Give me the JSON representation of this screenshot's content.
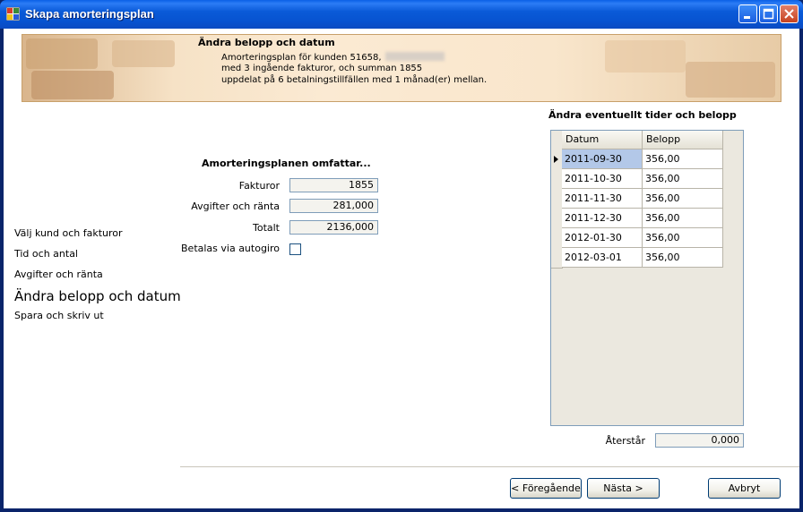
{
  "window": {
    "title": "Skapa amorteringsplan"
  },
  "banner": {
    "title": "Ändra belopp och datum",
    "line1_prefix": "Amorteringsplan för kunden 51658,",
    "line2": "med 3 ingående fakturor, och summan 1855",
    "line3": "uppdelat på 6 betalningstillfällen med 1 månad(er) mellan."
  },
  "nav": {
    "items": [
      {
        "label": "Välj kund och fakturor",
        "active": false
      },
      {
        "label": "Tid och antal",
        "active": false
      },
      {
        "label": "Avgifter och ränta",
        "active": false
      },
      {
        "label": "Ändra belopp och datum",
        "active": true
      },
      {
        "label": "Spara och skriv ut",
        "active": false
      }
    ]
  },
  "summary": {
    "heading": "Amorteringsplanen omfattar...",
    "fakturor_label": "Fakturor",
    "fakturor_value": "1855",
    "avgifter_label": "Avgifter och ränta",
    "avgifter_value": "281,000",
    "totalt_label": "Totalt",
    "totalt_value": "2136,000",
    "autogiro_label": "Betalas via autogiro",
    "autogiro_checked": false
  },
  "schedule": {
    "heading": "Ändra eventuellt tider och belopp",
    "columns": [
      "Datum",
      "Belopp"
    ],
    "rows": [
      {
        "datum": "2011-09-30",
        "belopp": "356,00"
      },
      {
        "datum": "2011-10-30",
        "belopp": "356,00"
      },
      {
        "datum": "2011-11-30",
        "belopp": "356,00"
      },
      {
        "datum": "2011-12-30",
        "belopp": "356,00"
      },
      {
        "datum": "2012-01-30",
        "belopp": "356,00"
      },
      {
        "datum": "2012-03-01",
        "belopp": "356,00"
      }
    ],
    "remaining_label": "Återstår",
    "remaining_value": "0,000"
  },
  "buttons": {
    "previous": "< Föregående",
    "next": "Nästa >",
    "cancel": "Avbryt"
  },
  "colors": {
    "titlebar": "#0a5ad8",
    "selected_cell": "#b3c8e8",
    "banner": "#f6e2c6"
  }
}
